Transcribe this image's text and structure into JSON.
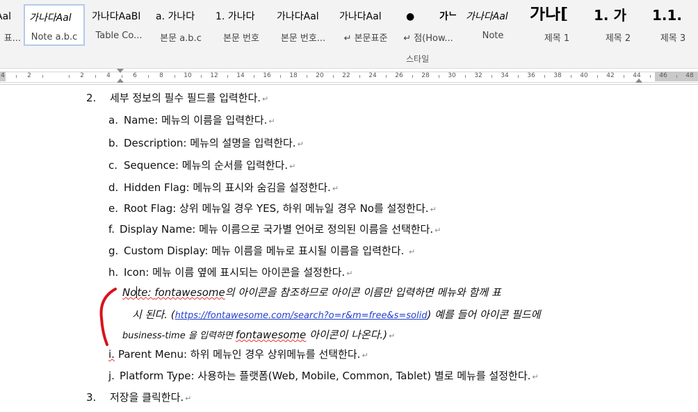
{
  "gallery": {
    "styles": [
      {
        "preview": "Aal",
        "name": "표...",
        "kind": "normal",
        "selected": false
      },
      {
        "preview": "가나다Aal",
        "name": "Note a.b.c",
        "kind": "italic",
        "selected": true
      },
      {
        "preview": "가나다AaBl",
        "name": "Table Co...",
        "kind": "normal",
        "selected": false
      },
      {
        "preview": "a. 가나다",
        "name": "본문 a.b.c",
        "kind": "normal",
        "selected": false
      },
      {
        "preview": "1. 가나다",
        "name": "본문 번호",
        "kind": "normal",
        "selected": false
      },
      {
        "preview": "가나다Aal",
        "name": "본문 번호...",
        "kind": "normal",
        "selected": false
      },
      {
        "preview": "가나다Aal",
        "name": "↵ 본문표준",
        "kind": "normal",
        "selected": false
      },
      {
        "preview": "●",
        "name": "↵ 점(How...",
        "kind": "normal",
        "selected": false
      },
      {
        "preview": "가ᄂ",
        "name": "",
        "kind": "normal",
        "selected": false
      },
      {
        "preview": "가나다Aal",
        "name": "Note",
        "kind": "italic",
        "selected": false
      },
      {
        "preview": "가나[",
        "name": "제목 1",
        "kind": "bold-big",
        "selected": false
      },
      {
        "preview": "1.  가",
        "name": "제목 2",
        "kind": "bold-mid",
        "selected": false
      },
      {
        "preview": "1.1.",
        "name": "제목 3",
        "kind": "bold-mid",
        "selected": false
      }
    ],
    "group_label": "스타일"
  },
  "ruler": {
    "numbers": [
      "4",
      "2",
      "",
      "2",
      "4",
      "6",
      "8",
      "10",
      "12",
      "14",
      "16",
      "18",
      "20",
      "22",
      "24",
      "26",
      "28",
      "30",
      "32",
      "34",
      "36",
      "38",
      "40",
      "42",
      "44",
      "46",
      "48"
    ]
  },
  "document": {
    "pilcrow": "↵",
    "step2": {
      "num": "2.",
      "text": "세부 정보의 필수 필드를 입력한다."
    },
    "items": [
      {
        "label": "a.",
        "text": "Name: 메뉴의 이름을 입력한다."
      },
      {
        "label": "b.",
        "text": "Description: 메뉴의 설명을 입력한다."
      },
      {
        "label": "c.",
        "text": "Sequence: 메뉴의 순서를 입력한다."
      },
      {
        "label": "d.",
        "text": "Hidden Flag: 메뉴의 표시와 숨김을 설정한다."
      },
      {
        "label": "e.",
        "text": "Root Flag: 상위 메뉴일 경우 YES, 하위 메뉴일 경우 No를 설정한다."
      },
      {
        "label": "f.",
        "text": "Display Name: 메뉴 이름으로 국가별 언어로 정의된 이름을 선택한다."
      },
      {
        "label": "g.",
        "text": "Custom Display: 메뉴 이름을 메뉴로 표시될 이름을 입력한다. "
      },
      {
        "label": "h.",
        "text": "Icon: 메뉴 이름 옆에 표시되는 아이콘을 설정한다."
      }
    ],
    "note": {
      "l1_a": "No",
      "l1_b": "te: ",
      "l1_c": "fontawesome",
      "l1_d": "의 아이콘을 참조하므로 아이콘 이름만 입력하면 메뉴와 함께 표",
      "l2_a": "시 된다. (",
      "l2_link": "https://fontawesome.com/search?o=r&m=free&s=solid",
      "l2_b": ") 예를 들어 아이콘 필드에",
      "l3_a": "business-time 을 입력하면 ",
      "l3_b": "fontawesome",
      "l3_c": " 아이콘이 나온다.)"
    },
    "item_i": {
      "label": "i.",
      "text": "Parent Menu: 하위 메뉴인 경우 상위메뉴를 선택한다."
    },
    "item_j": {
      "label": "j.",
      "text": "Platform Type: 사용하는 플랫폼(Web, Mobile, Common, Tablet) 별로 메뉴를 설정한다."
    },
    "step3": {
      "num": "3.",
      "text": "저장을 클릭한다."
    }
  },
  "colors": {
    "annotation": "#d9121b",
    "link": "#1f3fcf",
    "selected_border": "#b5c9e8"
  }
}
